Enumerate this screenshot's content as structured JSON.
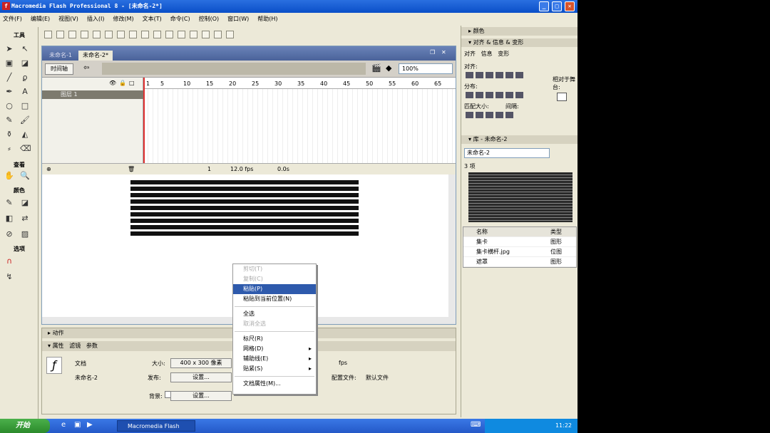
{
  "window": {
    "title": "Macromedia Flash Professional 8 - [未命名-2*]",
    "controls": [
      "_",
      "□",
      "✕"
    ]
  },
  "menubar": [
    "文件(F)",
    "编辑(E)",
    "视图(V)",
    "插入(I)",
    "修改(M)",
    "文本(T)",
    "命令(C)",
    "控制(O)",
    "窗口(W)",
    "帮助(H)"
  ],
  "tools": {
    "header": "工具",
    "view": "查看",
    "colors": "颜色",
    "options": "选项"
  },
  "doc": {
    "tabs": [
      "未命名-1",
      "未命名-2*"
    ],
    "timeline_button": "时间轴",
    "zoom": "100%",
    "ruler": [
      "1",
      "5",
      "10",
      "15",
      "20",
      "25",
      "30",
      "35",
      "40",
      "45",
      "50",
      "55",
      "60",
      "65"
    ],
    "layer": "图层 1",
    "frame": "1",
    "fps": "12.0 fps",
    "time": "0.0s"
  },
  "context_menu": [
    {
      "label": "剪切(T)",
      "disabled": true
    },
    {
      "label": "复制(C)",
      "disabled": true
    },
    {
      "label": "粘贴(P)",
      "selected": true
    },
    {
      "label": "粘贴到当前位置(N)"
    },
    {
      "sep": true
    },
    {
      "label": "全选"
    },
    {
      "label": "取消全选",
      "disabled": true
    },
    {
      "sep": true
    },
    {
      "label": "标尺(R)"
    },
    {
      "label": "网格(D)",
      "arrow": "▸"
    },
    {
      "label": "辅助线(E)",
      "arrow": "▸"
    },
    {
      "label": "贴紧(S)",
      "arrow": "▸"
    },
    {
      "sep": true
    },
    {
      "label": "文档属性(M)..."
    }
  ],
  "props": {
    "actions_header": "动作",
    "tabs": [
      "属性",
      "滤镜",
      "参数"
    ],
    "doc_label": "文档",
    "doc_name": "未命名-2",
    "size_label": "大小:",
    "size_value": "400 x 300 像素",
    "publish_label": "发布:",
    "publish_button": "设置...",
    "bg_label": "背景:",
    "fps_label": "fps",
    "profile_label": "配置文件:",
    "profile_value": "默认文件",
    "settings_button": "设置..."
  },
  "right_panel": {
    "colors_header": "颜色",
    "align_header": "对齐 & 信息 & 变形",
    "align_tabs": [
      "对齐",
      "信息",
      "变形"
    ],
    "align_label": "对齐:",
    "distribute_label": "分布:",
    "match_label": "匹配大小:",
    "spacing_label": "间隔:",
    "relative_label": "相对于舞台:",
    "library_header": "库 - 未命名-2",
    "library_select": "未命名-2",
    "item_count": "3 项",
    "col_name": "名称",
    "col_type": "类型",
    "items": [
      {
        "name": "集卡",
        "type": "图形"
      },
      {
        "name": "集卡横杆.jpg",
        "type": "位图"
      },
      {
        "name": "遮罩",
        "type": "图形"
      }
    ]
  },
  "taskbar": {
    "start": "开始",
    "task": "Macromedia Flash",
    "clock": "11:22"
  }
}
